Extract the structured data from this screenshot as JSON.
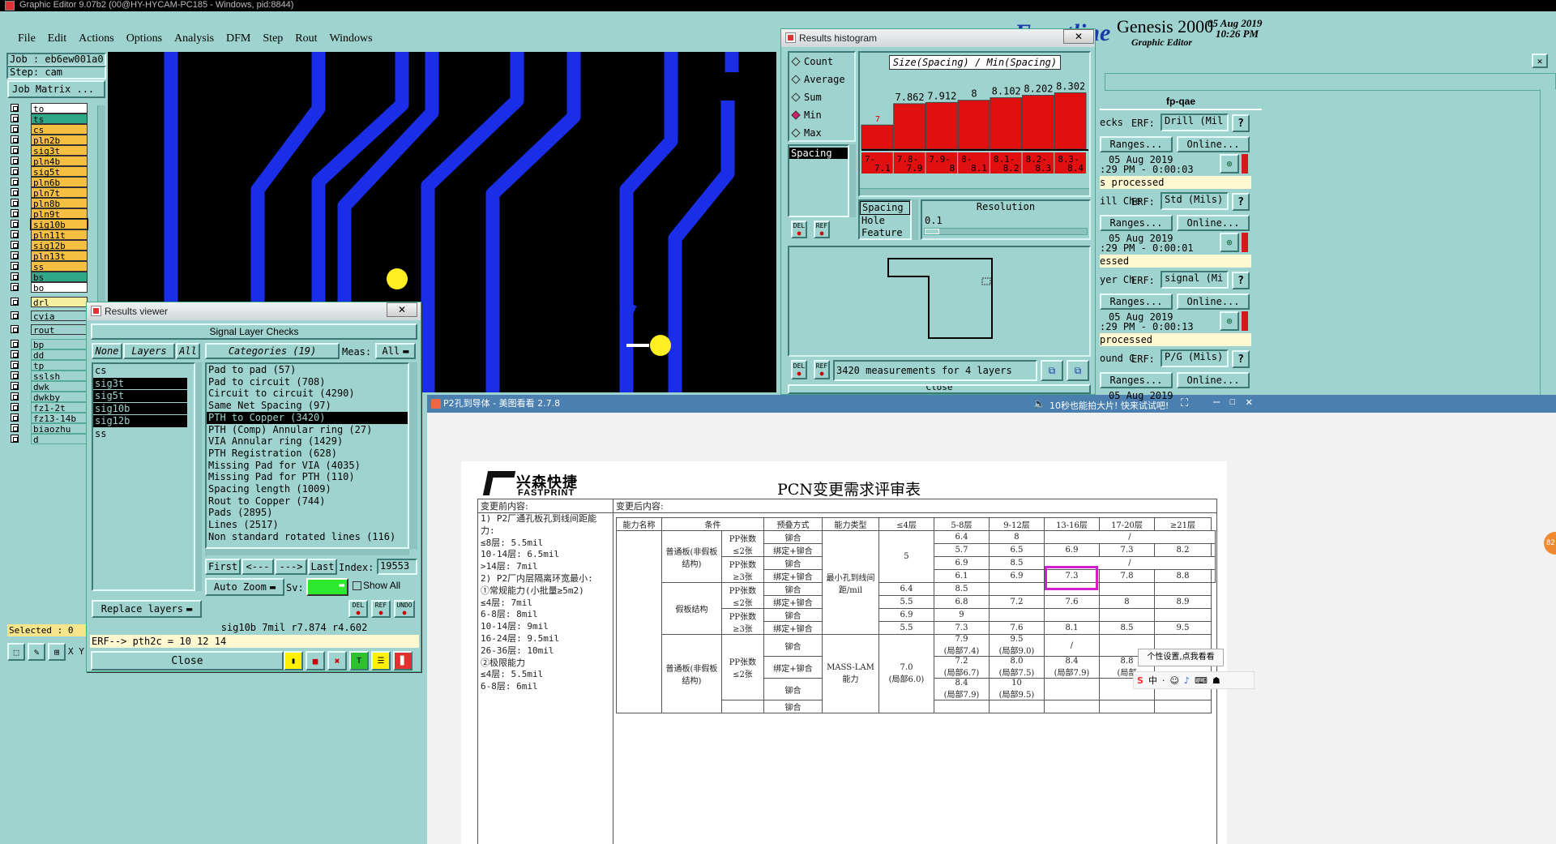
{
  "app_title": "Graphic Editor 9.07b2 (00@HY-HYCAM-PC185 - Windows, pid:8844)",
  "menu": [
    "File",
    "Edit",
    "Actions",
    "Options",
    "Analysis",
    "DFM",
    "Step",
    "Rout",
    "Windows"
  ],
  "brand": {
    "logo": "Frontline",
    "product": "Genesis 2000",
    "subtitle": "Graphic Editor",
    "date": "05 Aug 2019",
    "time": "10:26 PM"
  },
  "job": {
    "job_label": "Job : eb6ew001a0",
    "step_label": "Step: cam",
    "matrix_button": "Job Matrix ..."
  },
  "layers": [
    {
      "name": "to",
      "color": "#ffffff"
    },
    {
      "name": "ts",
      "color": "#2fa88a"
    },
    {
      "name": "cs",
      "color": "#f5c042"
    },
    {
      "name": "pln2b",
      "color": "#f5c042"
    },
    {
      "name": "sig3t",
      "color": "#f5c042"
    },
    {
      "name": "pln4b",
      "color": "#f5c042"
    },
    {
      "name": "sig5t",
      "color": "#f5c042"
    },
    {
      "name": "pln6b",
      "color": "#f5c042"
    },
    {
      "name": "pln7t",
      "color": "#f5c042"
    },
    {
      "name": "pln8b",
      "color": "#f5c042"
    },
    {
      "name": "pln9t",
      "color": "#f5c042"
    },
    {
      "name": "sig10b",
      "color": "#f5c042"
    },
    {
      "name": "pln11t",
      "color": "#f5c042"
    },
    {
      "name": "sig12b",
      "color": "#f5c042"
    },
    {
      "name": "pln13t",
      "color": "#f5c042"
    },
    {
      "name": "ss",
      "color": "#f5c042"
    },
    {
      "name": "bs",
      "color": "#2fa88a"
    },
    {
      "name": "bo",
      "color": "#ffffff"
    }
  ],
  "drill_layers": [
    {
      "name": "drl",
      "color": "#f5f0a0"
    },
    {
      "name": "cvia",
      "color": "#9ed3cf"
    },
    {
      "name": "rout",
      "color": "#9ed3cf"
    }
  ],
  "misc_layers": [
    "bp",
    "dd",
    "tp",
    "sslsh",
    "dwk",
    "dwkby",
    "fz1-2t",
    "fz13-14b",
    "biaozhu",
    "d"
  ],
  "selected_label": "Selected : 0",
  "results_viewer": {
    "title": "Results viewer",
    "header": "Signal Layer Checks",
    "none": "None",
    "layers": "Layers",
    "all": "All",
    "categories": "Categories (19)",
    "meas_label": "Meas:",
    "meas_value": "All",
    "layer_list": [
      "cs",
      "sig3t",
      "sig5t",
      "sig10b",
      "sig12b",
      "ss"
    ],
    "category_list": [
      "Pad to pad (57)",
      "Pad to circuit (708)",
      "Circuit to circuit (4290)",
      "Same Net Spacing (97)",
      "PTH to Copper (3420)",
      "PTH (Comp) Annular ring (27)",
      "VIA Annular ring (1429)",
      "PTH Registration (628)",
      "Missing Pad for VIA (4035)",
      "Missing Pad for PTH (110)",
      "Spacing length (1009)",
      "Rout to Copper (744)",
      "Pads (2895)",
      "Lines (2517)",
      "Non standard rotated lines (116)"
    ],
    "nav": {
      "first": "First",
      "prev": "<---",
      "next": "--->",
      "last": "Last",
      "index_label": "Index:",
      "index_value": "19553"
    },
    "auto_zoom": "Auto Zoom",
    "sv_label": "Sv:",
    "show_all": "Show All",
    "replace_layers": "Replace layers",
    "btn_del": "DEL",
    "btn_ref": "REF",
    "btn_undo": "UNDO",
    "status": "sig10b  7mil    r7.874   r4.602",
    "erf": "ERF--> pth2c = 10 12 14",
    "close": "Close"
  },
  "histogram": {
    "title": "Results histogram",
    "stats": [
      "Count",
      "Average",
      "Sum",
      "Min",
      "Max"
    ],
    "selected_stat": "Min",
    "heading": "Size(Spacing) / Min(Spacing)",
    "measure_list": [
      "Spacing"
    ],
    "type_list": [
      "Spacing",
      "Hole",
      "Feature"
    ],
    "resolution_label": "Resolution",
    "resolution_value": "0.1",
    "measurements": "3420 measurements for 4 layers",
    "close": "Close",
    "btn_del": "DEL",
    "btn_ref": "REF"
  },
  "chart_data": {
    "type": "bar",
    "title": "Size(Spacing) / Min(Spacing)",
    "categories": [
      "7-7.1",
      "7.8-7.9",
      "7.9-8",
      "8-8.1",
      "8.1-8.2",
      "8.2-8.3",
      "8.3-8.4"
    ],
    "value_labels": [
      "7",
      "7.862",
      "7.912",
      "8",
      "8.102",
      "8.202",
      "8.302"
    ],
    "values": [
      7,
      7.862,
      7.912,
      8,
      8.102,
      8.202,
      8.302
    ],
    "ylim": [
      0,
      8.4
    ]
  },
  "right_panel": {
    "title": "fp-qae",
    "rows": [
      {
        "name": "ecks",
        "erf": "ERF:",
        "value": "Drill (Mil",
        "ranges": "Ranges...",
        "online": "Online...",
        "date": "05 Aug 2019",
        "time": ":29 PM - 0:00:03",
        "status": "s processed"
      },
      {
        "name": "ill Che",
        "erf": "ERF:",
        "value": "Std (Mils)",
        "ranges": "Ranges...",
        "online": "Online...",
        "date": "05 Aug 2019",
        "time": ":29 PM - 0:00:01",
        "status": "essed"
      },
      {
        "name": "yer Ch",
        "erf": "ERF:",
        "value": "signal (Mi",
        "ranges": "Ranges...",
        "online": "Online...",
        "date": "05 Aug 2019",
        "time": ":29 PM - 0:00:13",
        "status": " processed"
      },
      {
        "name": "ound C",
        "erf": "ERF:",
        "value": "P/G (Mils)",
        "ranges": "Ranges...",
        "online": "Online...",
        "date": "05 Aug 2019",
        "time": "",
        "status": ""
      }
    ]
  },
  "viewer": {
    "title": "P2孔到导体 - 美图看看 2.7.8",
    "promo": "10秒也能拍大片! 快来试试吧!",
    "doc_company_cn": "兴森快捷",
    "doc_company_en": "FASTPRINT",
    "doc_title": "PCN变更需求评审表",
    "before_label": "变更前内容:",
    "after_label": "变更后内容:",
    "before_text": [
      "1) P2厂通孔板孔到线间距能",
      "力:",
      "≤8层: 5.5mil",
      "10-14层: 6.5mil",
      ">14层: 7mil",
      "2) P2厂内层隔离环宽最小:",
      "①常规能力(小批量≥5m2)",
      "≤4层: 7mil",
      "6-8层: 8mil",
      "10-14层: 9mil",
      "16-24层: 9.5mil",
      "26-36层: 10mil",
      "②极限能力",
      "≤4层: 5.5mil",
      "6-8层: 6mil"
    ],
    "table_header": [
      "能力名称",
      "条件",
      "",
      "预叠方式",
      "能力类型",
      "≤4层",
      "5-8层",
      "9-12层",
      "13-16层",
      "17-20层",
      "≥21层"
    ],
    "cond_a": "普通板(非假板结构)",
    "cond_b": "假板结构",
    "pp_le2": "PP张数≤2张",
    "pp_ge3": "PP张数≥3张",
    "riv": "铆合",
    "bond": "绑定+铆合",
    "cap": "最小孔到线间距/mil",
    "mass": "MASS-LAM能力",
    "rows_a": [
      [
        "6.4",
        "8",
        "",
        "/",
        ""
      ],
      [
        "5.7",
        "6.5",
        "6.9",
        "7.3",
        "8.2"
      ],
      [
        "6.9",
        "8.5",
        "",
        "/",
        ""
      ],
      [
        "6.1",
        "6.9",
        "7.3",
        "7.8",
        "8.8"
      ]
    ],
    "le4_a": "5",
    "rows_b": [
      [
        "6.4",
        "8.5",
        "",
        "",
        "",
        ""
      ],
      [
        "5.5",
        "6.8",
        "7.2",
        "7.6",
        "8",
        "8.9"
      ],
      [
        "6.9",
        "9",
        "",
        "",
        "",
        ""
      ],
      [
        "5.5",
        "7.3",
        "7.6",
        "8.1",
        "8.5",
        "9.5"
      ]
    ],
    "mass_rows": [
      [
        "7.9",
        "9.5",
        "/"
      ],
      [
        "(局部7.4)",
        "(局部9.0)",
        ""
      ],
      [
        "7.2",
        "8.0",
        "8.4",
        "8.8"
      ],
      [
        "(局部6.7)",
        "(局部7.5)",
        "(局部7.9)",
        "(局部"
      ],
      [
        "8.4",
        "10",
        ""
      ],
      [
        "(局部7.9)",
        "(局部9.5)",
        ""
      ]
    ],
    "mass_le4": "7.0",
    "mass_le4_sub": "(局部6.0)",
    "tooltip": "个性设置,点我看看",
    "tray_ime": "中"
  }
}
